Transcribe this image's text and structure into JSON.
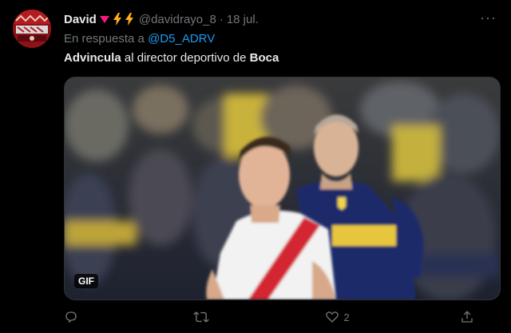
{
  "tweet": {
    "author": {
      "display_name": "David",
      "emoji_icons": [
        "heart-icon",
        "lightning-icon",
        "lightning-icon"
      ],
      "handle": "@davidrayo_8"
    },
    "separator": "·",
    "date": "18 jul.",
    "more_label": "···",
    "reply_prefix": "En respuesta a",
    "reply_mention": "@D5_ADRV",
    "text_parts": [
      "Advincula",
      " al director deportivo de ",
      "Boca"
    ],
    "media": {
      "badge": "GIF"
    },
    "actions": {
      "reply_count": "",
      "retweet_count": "",
      "like_count": "2",
      "share_count": ""
    }
  },
  "colors": {
    "background": "#000000",
    "text_primary": "#e7e9ea",
    "text_secondary": "#71767b",
    "link": "#1d9bf0",
    "heart": "#f91880",
    "lightning": "#ffad1f"
  }
}
